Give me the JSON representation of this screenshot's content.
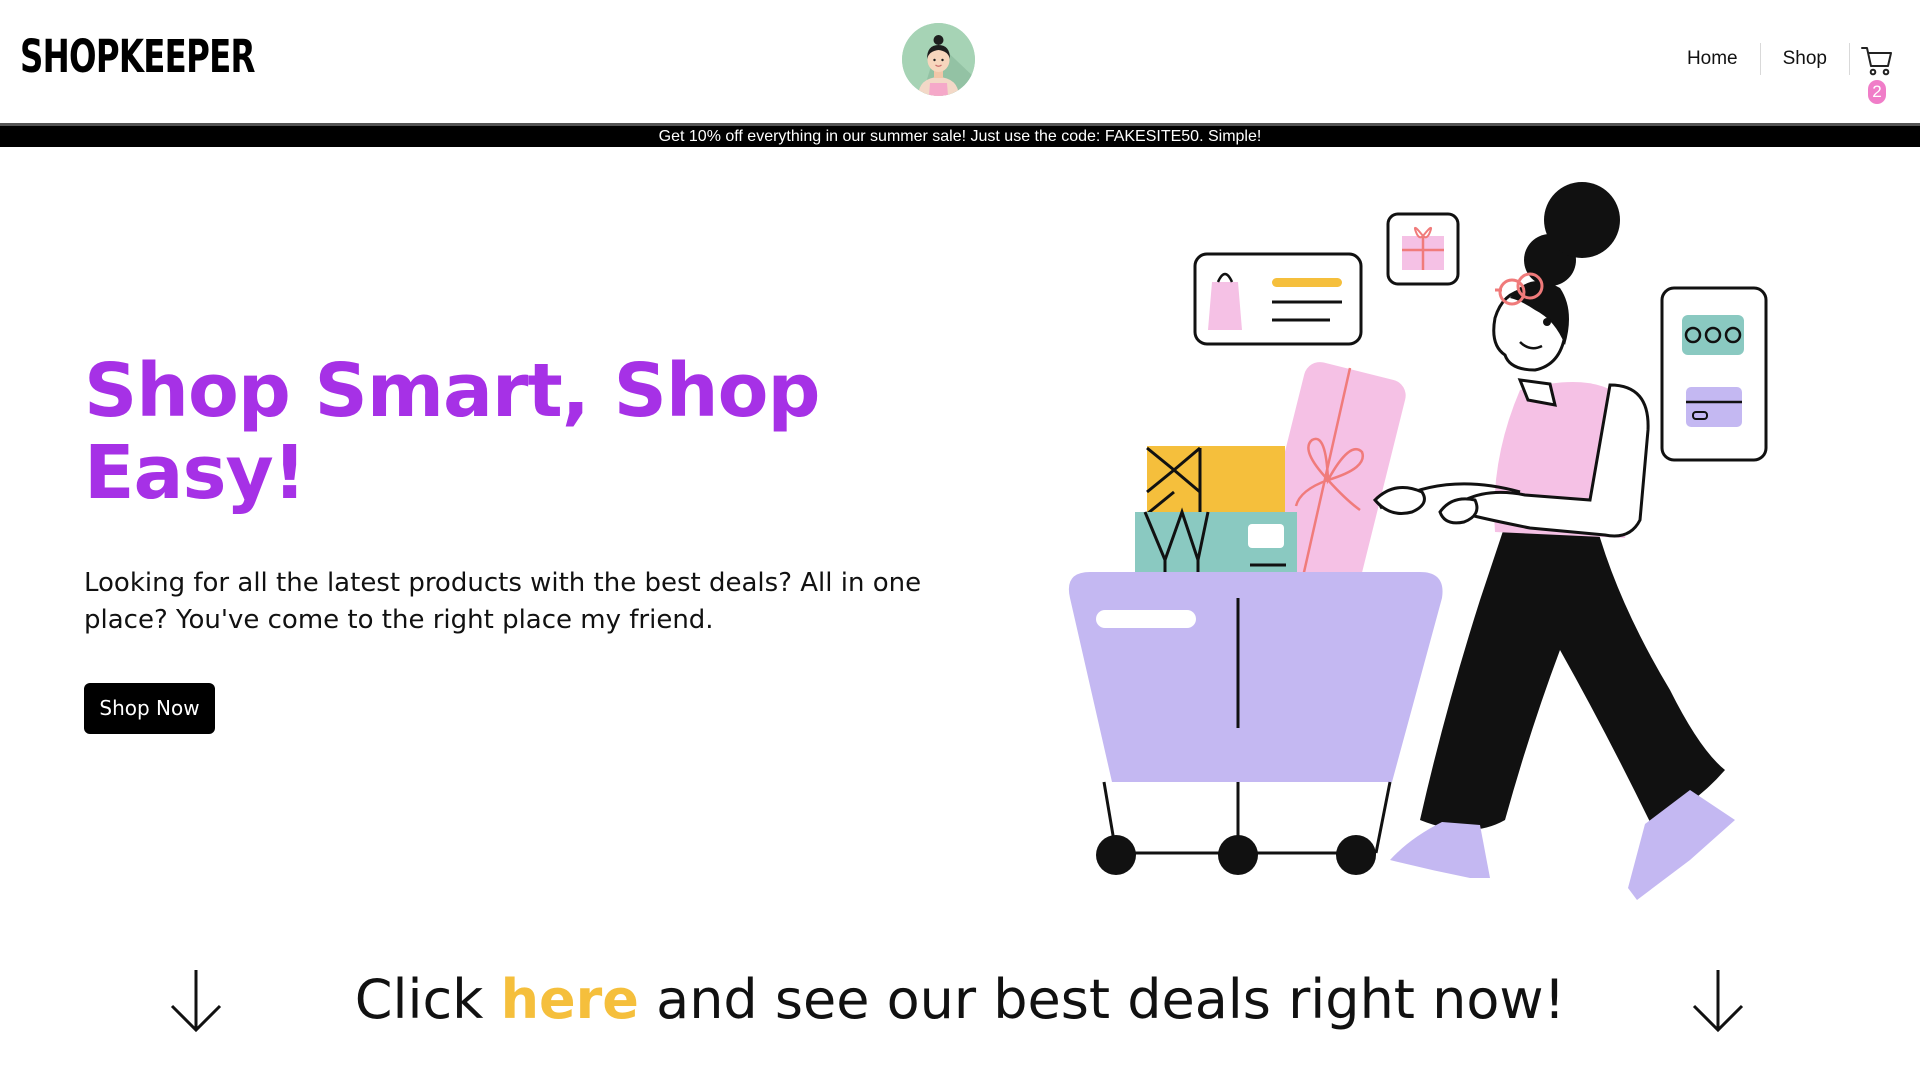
{
  "header": {
    "logo": "SHOPKEEPER",
    "nav": [
      {
        "label": "Home"
      },
      {
        "label": "Shop"
      }
    ],
    "cart": {
      "icon": "cart-icon",
      "count": "2",
      "badge_color": "#f07dc8"
    },
    "avatar": {
      "icon": "shopkeeper-avatar",
      "bg_color": "#a6d3b5"
    }
  },
  "banner": {
    "text": "Get 10% off everything in our summer sale! Just use the code: FAKESITE50. Simple!"
  },
  "hero": {
    "title": "Shop Smart, Shop Easy!",
    "subtitle": "Looking for all the latest products with the best deals? All in one place? You've come to the right place my friend.",
    "button_label": "Shop Now",
    "title_color": "#a631e6",
    "illustration": "woman-pushing-shopping-cart-illustration"
  },
  "cta": {
    "before": "Click ",
    "link": "here",
    "after": " and see our best deals right now!",
    "link_color": "#f5bf3c",
    "icons": [
      "arrow-down-icon",
      "arrow-down-icon"
    ]
  },
  "colors": {
    "accent_purple": "#a631e6",
    "accent_yellow": "#f5bf3c",
    "lavender": "#c4b8f2",
    "pink": "#f5c1e5",
    "teal": "#8ac9c1"
  }
}
